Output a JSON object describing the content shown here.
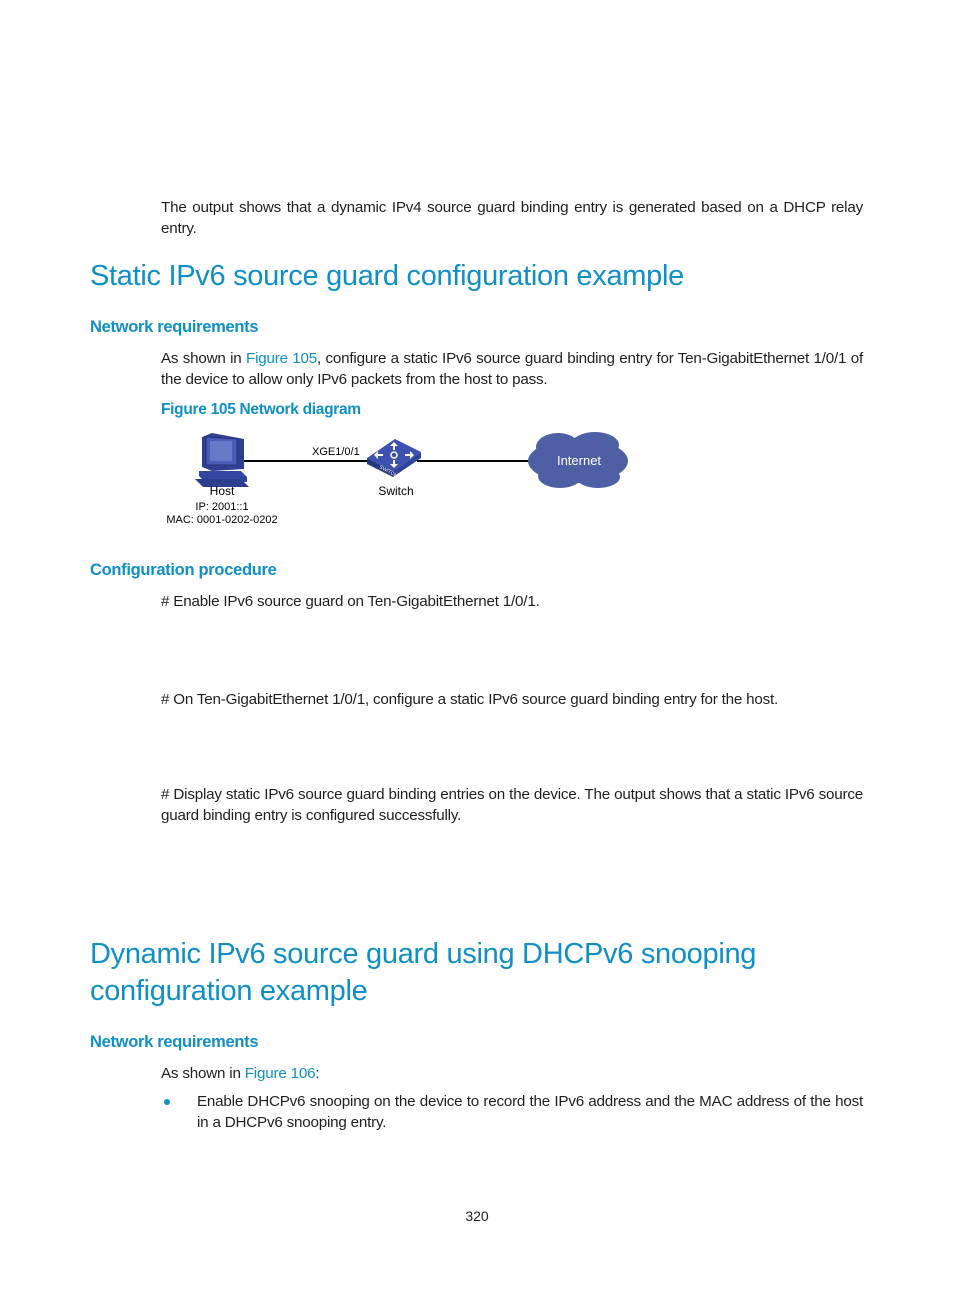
{
  "intro": {
    "paragraph": "The output shows that a dynamic IPv4 source guard binding entry is generated based on a DHCP relay entry."
  },
  "section1": {
    "title": "Static IPv6 source guard configuration example",
    "network_requirements": {
      "heading": "Network requirements",
      "text_before_link": "As shown in ",
      "link": "Figure 105",
      "text_after_link": ", configure a static IPv6 source guard binding entry for Ten-GigabitEthernet 1/0/1 of the device to allow only IPv6 packets from the host to pass.",
      "figure_caption": "Figure 105 Network diagram"
    },
    "diagram": {
      "host_label": "Host",
      "host_ip": "IP: 2001::1",
      "host_mac": "MAC: 0001-0202-0202",
      "port_label": "XGE1/0/1",
      "switch_label": "Switch",
      "switch_badge": "SWITCH",
      "cloud_label": "Internet",
      "colors": {
        "device_blue": "#3b4fa6",
        "cloud_blue": "#4e5fa3"
      }
    },
    "configuration_procedure": {
      "heading": "Configuration procedure",
      "step1": "# Enable IPv6 source guard on Ten-GigabitEthernet 1/0/1.",
      "step2": "# On Ten-GigabitEthernet 1/0/1, configure a static IPv6 source guard binding entry for the host.",
      "step3": "# Display static IPv6 source guard binding entries on the device. The output shows that a static IPv6 source guard binding entry is configured successfully."
    }
  },
  "section2": {
    "title": "Dynamic IPv6 source guard using DHCPv6 snooping configuration example",
    "network_requirements": {
      "heading": "Network requirements",
      "text_before_link": "As shown in ",
      "link": "Figure 106",
      "text_after_link": ":",
      "bullets": [
        "Enable DHCPv6 snooping on the device to record the IPv6 address and the MAC address of the host in a DHCPv6 snooping entry."
      ]
    }
  },
  "footer": {
    "page_number": "320"
  },
  "colors": {
    "heading_blue": "#0f8fc7",
    "body_text": "#1f1f1f"
  }
}
